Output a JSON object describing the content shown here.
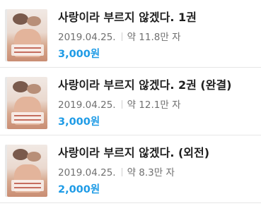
{
  "books": [
    {
      "title": "사랑이라 부르지 않겠다. 1권",
      "date": "2019.04.25.",
      "length": "약 11.8만 자",
      "price": "3,000원"
    },
    {
      "title": "사랑이라 부르지 않겠다. 2권 (완결)",
      "date": "2019.04.25.",
      "length": "약 12.1만 자",
      "price": "3,000원"
    },
    {
      "title": "사랑이라 부르지 않겠다. (외전)",
      "date": "2019.04.25.",
      "length": "약 8.3만 자",
      "price": "2,000원"
    }
  ],
  "colors": {
    "price": "#1e9be6",
    "title": "#1f1f1f",
    "meta": "#707070",
    "divider": "#e6e6e6"
  }
}
